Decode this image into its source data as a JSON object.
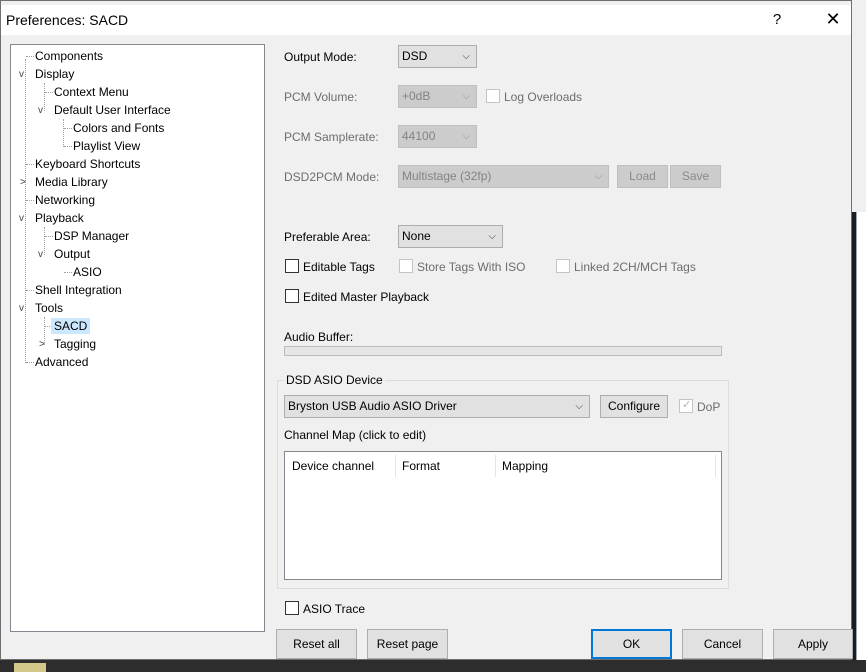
{
  "window": {
    "title": "Preferences: SACD"
  },
  "tree": {
    "items": [
      {
        "label": "Components"
      },
      {
        "label": "Display"
      },
      {
        "label": "Context Menu"
      },
      {
        "label": "Default User Interface"
      },
      {
        "label": "Colors and Fonts"
      },
      {
        "label": "Playlist View"
      },
      {
        "label": "Keyboard Shortcuts"
      },
      {
        "label": "Media Library"
      },
      {
        "label": "Networking"
      },
      {
        "label": "Playback"
      },
      {
        "label": "DSP Manager"
      },
      {
        "label": "Output"
      },
      {
        "label": "ASIO"
      },
      {
        "label": "Shell Integration"
      },
      {
        "label": "Tools"
      },
      {
        "label": "SACD"
      },
      {
        "label": "Tagging"
      },
      {
        "label": "Advanced"
      }
    ],
    "selected": "SACD"
  },
  "output_mode": {
    "label": "Output Mode:",
    "value": "DSD"
  },
  "pcm_volume": {
    "label": "PCM Volume:",
    "value": "+0dB"
  },
  "log_overloads": {
    "label": "Log Overloads",
    "checked": false
  },
  "pcm_samplerate": {
    "label": "PCM Samplerate:",
    "value": "44100"
  },
  "dsd2pcm_mode": {
    "label": "DSD2PCM Mode:",
    "value": "Multistage (32fp)",
    "load_label": "Load",
    "save_label": "Save"
  },
  "preferable_area": {
    "label": "Preferable Area:",
    "value": "None"
  },
  "editable_tags": {
    "label": "Editable Tags",
    "checked": false
  },
  "store_tags_iso": {
    "label": "Store Tags With ISO",
    "checked": false
  },
  "linked_tags": {
    "label": "Linked 2CH/MCH Tags",
    "checked": false
  },
  "edited_master": {
    "label": "Edited Master Playback",
    "checked": false
  },
  "audio_buffer": {
    "label": "Audio Buffer:",
    "fill": 0
  },
  "dsd_asio": {
    "group_label": "DSD ASIO Device",
    "device": "Bryston USB Audio ASIO Driver",
    "configure_label": "Configure",
    "dop_label": "DoP",
    "dop_checked": true,
    "channel_map_label": "Channel Map (click to edit)",
    "columns": [
      "Device channel",
      "Format",
      "Mapping"
    ]
  },
  "asio_trace": {
    "label": "ASIO Trace",
    "checked": false
  },
  "buttons": {
    "reset_all": "Reset all",
    "reset_page": "Reset page",
    "ok": "OK",
    "cancel": "Cancel",
    "apply": "Apply"
  },
  "icons": {
    "help": "?",
    "close": "✕",
    "expanded": "v",
    "collapsed": ">",
    "dropdown": "chevron-down-icon"
  }
}
